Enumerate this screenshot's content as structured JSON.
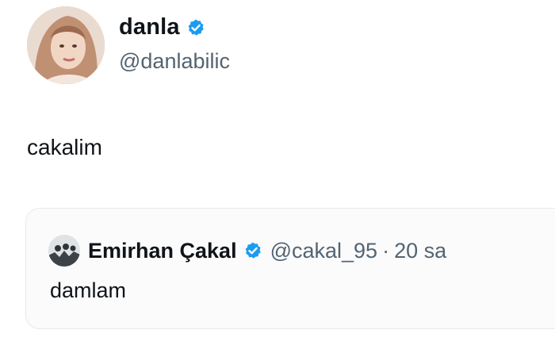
{
  "tweet": {
    "author": {
      "display_name": "danla",
      "handle": "@danlabilic",
      "verified": true
    },
    "text": "cakalim"
  },
  "quoted_tweet": {
    "author": {
      "display_name": "Emirhan Çakal",
      "handle": "@cakal_95",
      "verified": true
    },
    "separator": "·",
    "time": "20 sa",
    "text": "damlam"
  },
  "colors": {
    "verified_badge": "#1d9bf0",
    "secondary_text": "#536471",
    "card_border": "#e6e9ec"
  },
  "icons": {
    "verified": "verified-badge-icon"
  }
}
